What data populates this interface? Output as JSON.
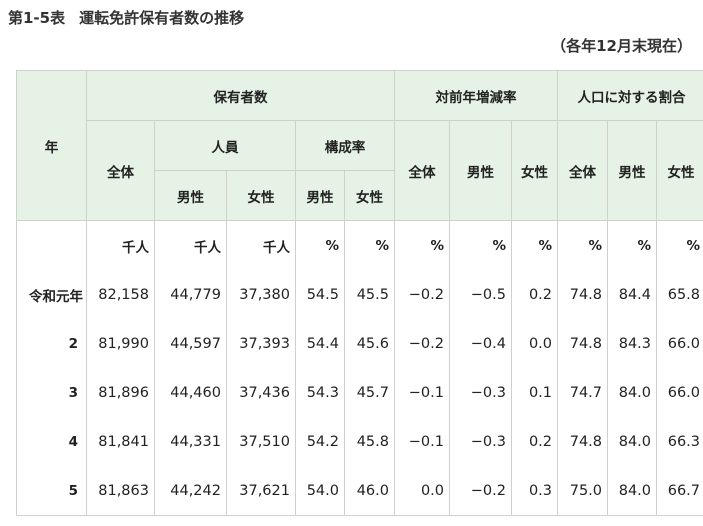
{
  "title": {
    "number": "第1-5表",
    "text": "運転免許保有者数の推移"
  },
  "as_of": "（各年12月末現在）",
  "table": {
    "headers": {
      "year": "年",
      "holders": "保有者数",
      "persons": "人員",
      "composition": "構成率",
      "yoy": "対前年増減率",
      "population_ratio": "人口に対する割合",
      "total": "全体",
      "male": "男性",
      "female": "女性"
    },
    "units": [
      "千人",
      "千人",
      "千人",
      "%",
      "%",
      "%",
      "%",
      "%",
      "%",
      "%",
      "%"
    ],
    "rows": [
      {
        "year": "令和元年",
        "values": [
          "82,158",
          "44,779",
          "37,380",
          "54.5",
          "45.5",
          "−0.2",
          "−0.5",
          "0.2",
          "74.8",
          "84.4",
          "65.8"
        ]
      },
      {
        "year": "2",
        "values": [
          "81,990",
          "44,597",
          "37,393",
          "54.4",
          "45.6",
          "−0.2",
          "−0.4",
          "0.0",
          "74.8",
          "84.3",
          "66.0"
        ]
      },
      {
        "year": "3",
        "values": [
          "81,896",
          "44,460",
          "37,436",
          "54.3",
          "45.7",
          "−0.1",
          "−0.3",
          "0.1",
          "74.7",
          "84.0",
          "66.0"
        ]
      },
      {
        "year": "4",
        "values": [
          "81,841",
          "44,331",
          "37,510",
          "54.2",
          "45.8",
          "−0.1",
          "−0.3",
          "0.2",
          "74.8",
          "84.0",
          "66.3"
        ]
      },
      {
        "year": "5",
        "values": [
          "81,863",
          "44,242",
          "37,621",
          "54.0",
          "46.0",
          "0.0",
          "−0.2",
          "0.3",
          "75.0",
          "84.0",
          "66.7"
        ]
      }
    ]
  }
}
